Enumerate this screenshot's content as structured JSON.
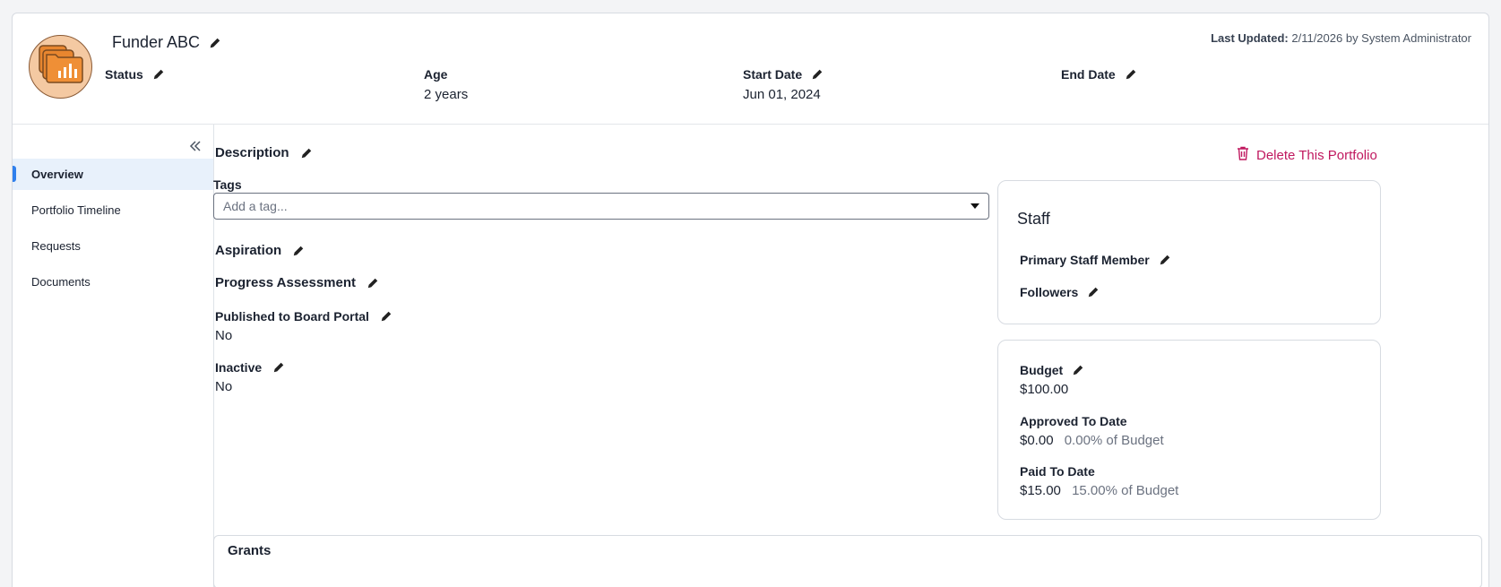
{
  "header": {
    "title": "Funder ABC",
    "last_updated_label": "Last Updated:",
    "last_updated_value": "2/11/2026 by System Administrator",
    "fields": {
      "status": {
        "label": "Status",
        "value": ""
      },
      "age": {
        "label": "Age",
        "value": "2 years"
      },
      "start_date": {
        "label": "Start Date",
        "value": "Jun 01, 2024"
      },
      "end_date": {
        "label": "End Date",
        "value": ""
      }
    },
    "avatar_icon": "folder-chart-icon",
    "avatar_bg": "#f4c9a2",
    "avatar_accent": "#e8862f"
  },
  "sidebar": {
    "collapse_icon": "double-chevron-left-icon",
    "items": [
      {
        "label": "Overview",
        "active": true
      },
      {
        "label": "Portfolio Timeline",
        "active": false
      },
      {
        "label": "Requests",
        "active": false
      },
      {
        "label": "Documents",
        "active": false
      }
    ],
    "active_color": "#2f80ed"
  },
  "main": {
    "description_label": "Description",
    "delete_label": "Delete This Portfolio",
    "delete_color": "#c0185f",
    "tags_label": "Tags",
    "tags_placeholder": "Add a tag...",
    "aspiration_label": "Aspiration",
    "progress_label": "Progress Assessment",
    "published_label": "Published to Board Portal",
    "published_value": "No",
    "inactive_label": "Inactive",
    "inactive_value": "No",
    "grants_title": "Grants"
  },
  "staff_panel": {
    "title": "Staff",
    "primary_label": "Primary Staff Member",
    "followers_label": "Followers"
  },
  "budget_panel": {
    "budget_label": "Budget",
    "budget_value": "$100.00",
    "approved_label": "Approved To Date",
    "approved_value": "$0.00",
    "approved_pct": "0.00% of Budget",
    "paid_label": "Paid To Date",
    "paid_value": "$15.00",
    "paid_pct": "15.00% of Budget"
  }
}
